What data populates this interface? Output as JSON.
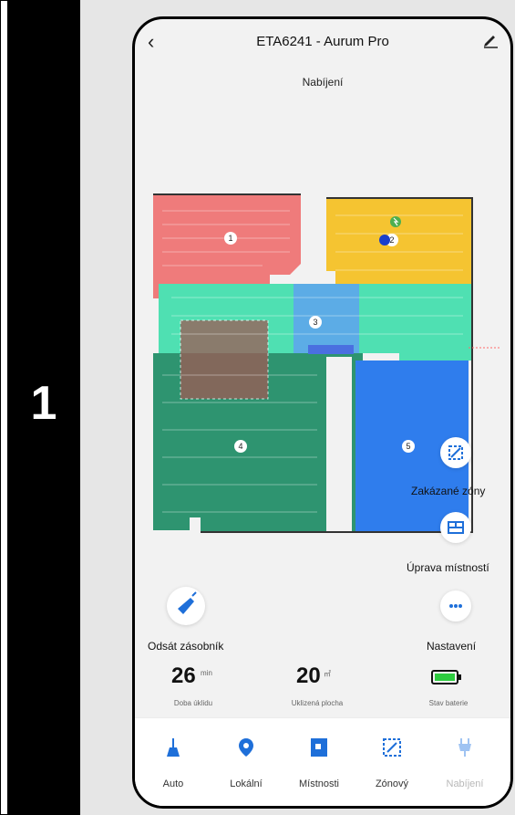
{
  "step_number": "1",
  "header": {
    "title": "ETA6241 - Aurum Pro",
    "status": "Nabíjení"
  },
  "map": {
    "rooms": [
      {
        "label": "1"
      },
      {
        "label": "2"
      },
      {
        "label": "3"
      },
      {
        "label": "4"
      },
      {
        "label": "5"
      }
    ]
  },
  "actions": {
    "forbidden_zones": "Zakázané zóny",
    "room_edit": "Úprava místností",
    "empty_bin": "Odsát zásobník",
    "settings": "Nastavení"
  },
  "stats": {
    "time": {
      "value": "26",
      "unit": "min",
      "label": "Doba úklidu"
    },
    "area": {
      "value": "20",
      "unit": "㎡",
      "label": "Uklizená plocha"
    },
    "battery": {
      "label": "Stav baterie"
    }
  },
  "tabs": [
    {
      "label": "Auto",
      "icon": "broom-icon"
    },
    {
      "label": "Lokální",
      "icon": "location-pin-icon"
    },
    {
      "label": "Místnosti",
      "icon": "room-icon"
    },
    {
      "label": "Zónový",
      "icon": "zone-icon"
    },
    {
      "label": "Nabíjení",
      "icon": "charging-plug-icon"
    }
  ],
  "colors": {
    "accent": "#1e6fd9",
    "room1": "#ef7b7b",
    "room2": "#f5c431",
    "room3": "#5da9e9",
    "room4": "#2e9470",
    "room5": "#2f7ded",
    "corridor": "#4fe0b2"
  }
}
